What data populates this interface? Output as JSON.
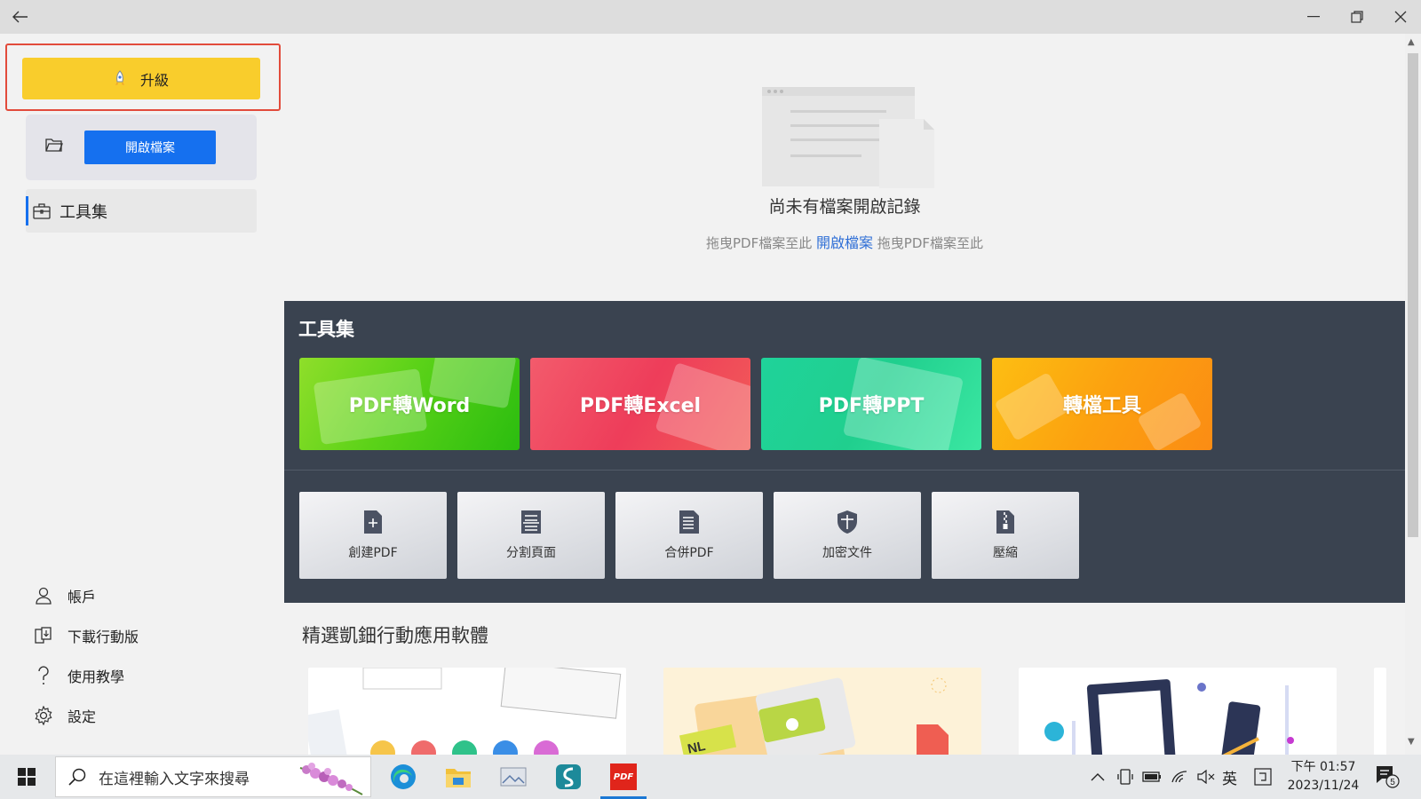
{
  "sidebar": {
    "upgrade_label": "升級",
    "open_button_label": "開啟檔案",
    "tools_label": "工具集",
    "bottom_items": [
      {
        "label": "帳戶",
        "icon": "user-icon"
      },
      {
        "label": "下載行動版",
        "icon": "mobile-download-icon"
      },
      {
        "label": "使用教學",
        "icon": "question-icon"
      },
      {
        "label": "設定",
        "icon": "gear-icon"
      }
    ]
  },
  "main": {
    "empty_title": "尚未有檔案開啟記錄",
    "empty_hint_prefix": "拖曳PDF檔案至此",
    "empty_hint_link": "開啟檔案",
    "empty_hint_suffix": "拖曳PDF檔案至此",
    "tools_heading": "工具集",
    "big_tools": [
      "PDF轉Word",
      "PDF轉Excel",
      "PDF轉PPT",
      "轉檔工具"
    ],
    "small_tools": [
      {
        "label": "創建PDF",
        "icon": "create-pdf-icon"
      },
      {
        "label": "分割頁面",
        "icon": "split-pages-icon"
      },
      {
        "label": "合併PDF",
        "icon": "merge-pdf-icon"
      },
      {
        "label": "加密文件",
        "icon": "encrypt-shield-icon"
      },
      {
        "label": "壓縮",
        "icon": "compress-zip-icon"
      }
    ],
    "apps_heading": "精選凱鈿行動應用軟體",
    "app_card_2_tag": "NL"
  },
  "taskbar": {
    "search_placeholder": "在這裡輸入文字來搜尋",
    "pdf_app_label": "PDF",
    "ime_label": "英",
    "time": "下午 01:57",
    "date": "2023/11/24",
    "notification_count": "5"
  },
  "colors": {
    "upgrade": "#f9cd2c",
    "primary": "#1570ef",
    "tools_panel": "#3a4350",
    "highlight_border": "#e24b3b"
  }
}
